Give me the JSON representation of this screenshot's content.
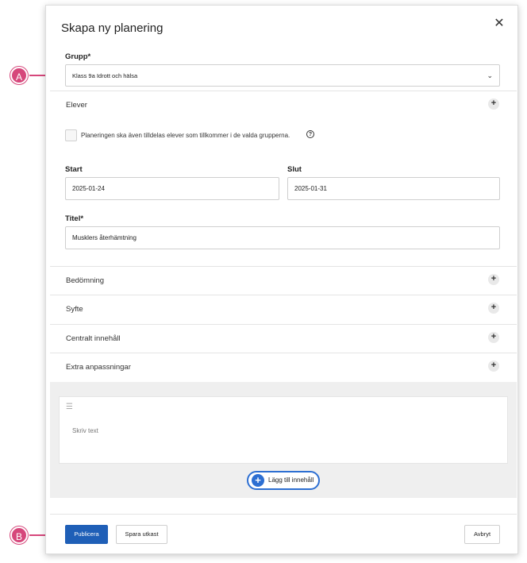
{
  "dialog": {
    "title": "Skapa ny planering",
    "close_icon": "close-icon"
  },
  "group": {
    "label": "Grupp*",
    "value": "Klass 9a Idrott och hälsa",
    "chevron_icon": "chevron-down-icon"
  },
  "students": {
    "label": "Elever",
    "expand_icon": "plus-icon"
  },
  "assign_checkbox": {
    "label": "Planeringen ska även tilldelas elever som tillkommer i de valda grupperna.",
    "checked": false,
    "help_icon": "help-icon"
  },
  "start": {
    "label": "Start",
    "value": "2025-01-24"
  },
  "end": {
    "label": "Slut",
    "value": "2025-01-31"
  },
  "title_field": {
    "label": "Titel*",
    "value": "Musklers återhämtning"
  },
  "sections": [
    {
      "label": "Bedömning"
    },
    {
      "label": "Syfte"
    },
    {
      "label": "Centralt innehåll"
    },
    {
      "label": "Extra anpassningar"
    }
  ],
  "editor": {
    "placeholder": "Skriv text",
    "toolbar_icon": "text-format-icon"
  },
  "add_content": {
    "label": "Lägg till innehåll",
    "icon": "add-circle-icon"
  },
  "footer": {
    "publish": "Publicera",
    "save_draft": "Spara utkast",
    "cancel": "Avbryt"
  },
  "callouts": [
    {
      "letter": "A"
    },
    {
      "letter": "B"
    }
  ],
  "colors": {
    "primary": "#1f5fb7",
    "accent_add": "#2d6fd2",
    "callout": "#d6477b"
  }
}
